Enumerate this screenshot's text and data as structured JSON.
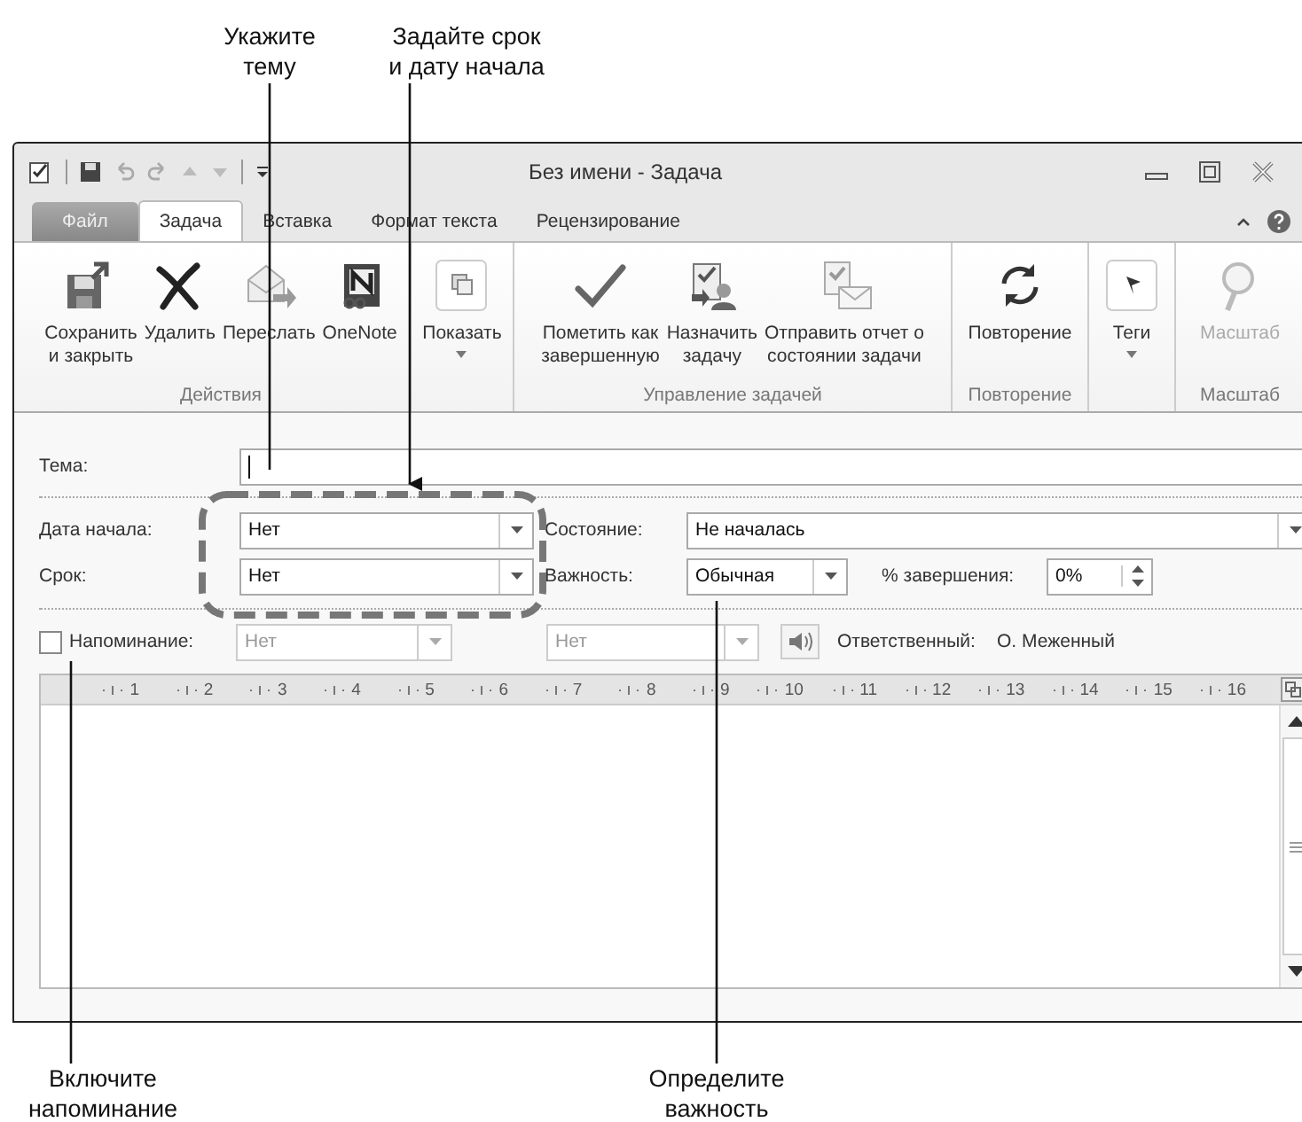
{
  "annotations": [
    {
      "lines": [
        "Укажите",
        "тему"
      ]
    },
    {
      "lines": [
        "Задайте срок",
        "и дату начала"
      ]
    },
    {
      "lines": [
        "Включите",
        "напоминание"
      ]
    },
    {
      "lines": [
        "Определите",
        "важность"
      ]
    }
  ],
  "window": {
    "title": "Без имени - Задача"
  },
  "tabs": [
    {
      "label": "Файл",
      "selected": false,
      "kind": "file"
    },
    {
      "label": "Задача",
      "selected": true,
      "kind": "tab"
    },
    {
      "label": "Вставка",
      "selected": false,
      "kind": "tab"
    },
    {
      "label": "Формат текста",
      "selected": false,
      "kind": "tab"
    },
    {
      "label": "Рецензирование",
      "selected": false,
      "kind": "tab"
    }
  ],
  "ribbon": [
    {
      "label": "Действия",
      "buttons": [
        {
          "lines": [
            "Сохранить",
            "и закрыть"
          ],
          "menu": false,
          "disabled": false
        },
        {
          "lines": [
            "Удалить"
          ],
          "menu": false,
          "disabled": false
        },
        {
          "lines": [
            "Переслать"
          ],
          "menu": false,
          "disabled": false
        },
        {
          "lines": [
            "OneNote"
          ],
          "menu": false,
          "disabled": false
        }
      ]
    },
    {
      "buttons": [
        {
          "lines": [
            "Показать"
          ],
          "menu": true,
          "disabled": false
        }
      ]
    },
    {
      "label": "Управление задачей",
      "buttons": [
        {
          "lines": [
            "Пометить как",
            "завершенную"
          ],
          "menu": false,
          "disabled": false
        },
        {
          "lines": [
            "Назначить",
            "задачу"
          ],
          "menu": false,
          "disabled": false
        },
        {
          "lines": [
            "Отправить отчет о",
            "состоянии задачи"
          ],
          "menu": false,
          "disabled": false
        }
      ]
    },
    {
      "label": "Повторение",
      "buttons": [
        {
          "lines": [
            "Повторение"
          ],
          "menu": false,
          "disabled": false
        }
      ]
    },
    {
      "buttons": [
        {
          "lines": [
            "Теги"
          ],
          "menu": true,
          "disabled": false
        }
      ]
    },
    {
      "label": "Масштаб",
      "buttons": [
        {
          "lines": [
            "Масштаб"
          ],
          "menu": false,
          "disabled": true
        }
      ]
    }
  ],
  "form": {
    "subject_label": "Тема:",
    "start_label": "Дата начала:",
    "start_value": "Нет",
    "due_label": "Срок:",
    "due_value": "Нет",
    "status_label": "Состояние:",
    "status_value": "Не началась",
    "priority_label": "Важность:",
    "priority_value": "Обычная",
    "complete_label": "% завершения:",
    "complete_value": "0%",
    "reminder": {
      "label": "Напоминание:",
      "checked": false,
      "date": "Нет",
      "time": "Нет",
      "disabled": true
    },
    "owner_label": "Ответственный:",
    "owner_value": "О. Меженный"
  },
  "ruler": [
    "1",
    "2",
    "3",
    "4",
    "5",
    "6",
    "7",
    "8",
    "9",
    "10",
    "11",
    "12",
    "13",
    "14",
    "15",
    "16"
  ]
}
